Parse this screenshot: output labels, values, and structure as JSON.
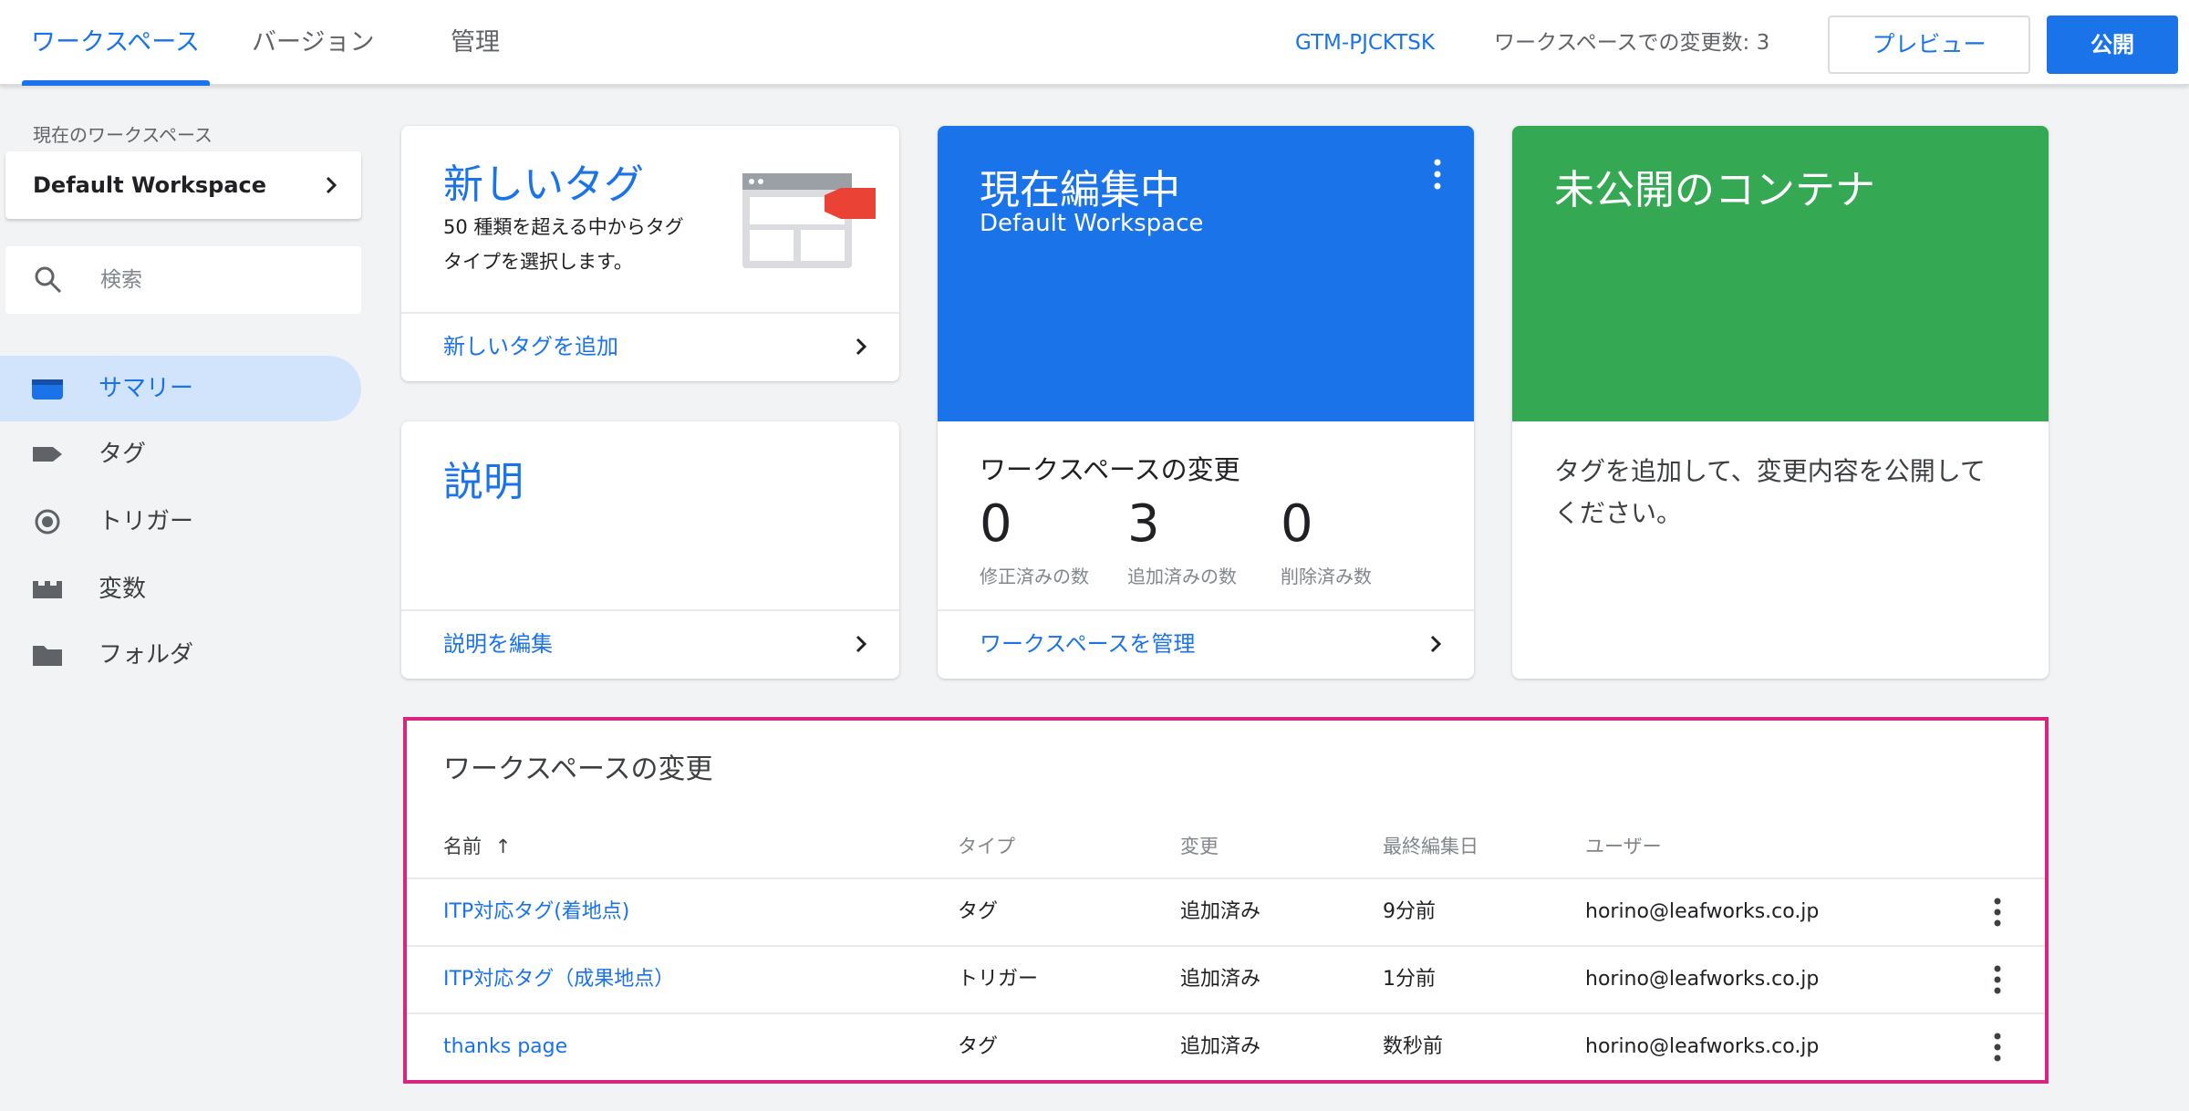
{
  "topbar": {
    "tabs": [
      {
        "label": "ワークスペース",
        "active": true
      },
      {
        "label": "バージョン",
        "active": false
      },
      {
        "label": "管理",
        "active": false
      }
    ],
    "container_id": "GTM-PJCKTSK",
    "workspace_changes": "ワークスペースでの変更数: 3",
    "preview_label": "プレビュー",
    "publish_label": "公開"
  },
  "sidebar": {
    "current_workspace_caption": "現在のワークスペース",
    "workspace_name": "Default Workspace",
    "search_placeholder": "検索",
    "items": [
      {
        "label": "サマリー",
        "icon": "summary-icon",
        "active": true
      },
      {
        "label": "タグ",
        "icon": "tag-icon",
        "active": false
      },
      {
        "label": "トリガー",
        "icon": "trigger-icon",
        "active": false
      },
      {
        "label": "変数",
        "icon": "variable-icon",
        "active": false
      },
      {
        "label": "フォルダ",
        "icon": "folder-icon",
        "active": false
      }
    ]
  },
  "cards": {
    "new_tag": {
      "title": "新しいタグ",
      "description": "50 種類を超える中からタグタイプを選択します。",
      "link": "新しいタグを追加"
    },
    "description": {
      "title": "説明",
      "link": "説明を編集"
    },
    "editing": {
      "title": "現在編集中",
      "workspace": "Default Workspace",
      "changes_heading": "ワークスペースの変更",
      "stats": [
        {
          "value": "0",
          "label": "修正済みの数"
        },
        {
          "value": "3",
          "label": "追加済みの数"
        },
        {
          "value": "0",
          "label": "削除済み数"
        }
      ],
      "link": "ワークスペースを管理"
    },
    "unpublished": {
      "title": "未公開のコンテナ",
      "body": "タグを追加して、変更内容を公開してください。"
    }
  },
  "changes_table": {
    "title": "ワークスペースの変更",
    "columns": [
      "名前",
      "タイプ",
      "変更",
      "最終編集日",
      "ユーザー"
    ],
    "sort_indicator": "↑",
    "rows": [
      {
        "name": "ITP対応タグ(着地点)",
        "type": "タグ",
        "change": "追加済み",
        "edited": "9分前",
        "user": "horino@leafworks.co.jp"
      },
      {
        "name": "ITP対応タグ（成果地点）",
        "type": "トリガー",
        "change": "追加済み",
        "edited": "1分前",
        "user": "horino@leafworks.co.jp"
      },
      {
        "name": "thanks page",
        "type": "タグ",
        "change": "追加済み",
        "edited": "数秒前",
        "user": "horino@leafworks.co.jp"
      }
    ]
  },
  "colors": {
    "accent": "#1a73e8",
    "editing_card": "#1a73e8",
    "unpublished_card": "#34a853",
    "highlight_border": "#d6267f"
  }
}
